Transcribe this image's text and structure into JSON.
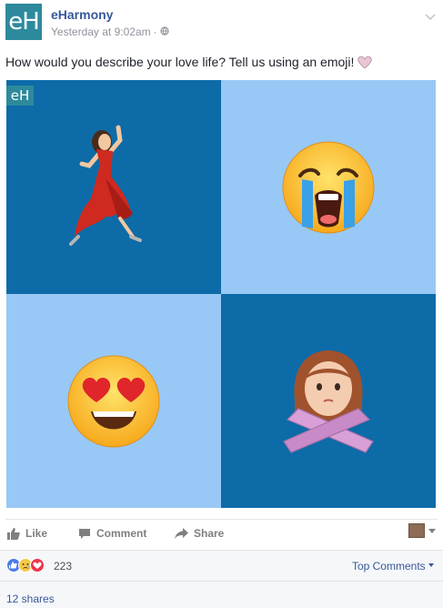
{
  "post": {
    "author": "eHarmony",
    "avatar_text": "eH",
    "timestamp": "Yesterday at 9:02am",
    "separator": "·",
    "message": "How would you describe your love life? Tell us using an emoji!"
  },
  "image": {
    "brand_text": "eH",
    "tiles": [
      {
        "emoji": "dancer-woman",
        "background": "#0d6ba8"
      },
      {
        "emoji": "loudly-crying-face",
        "background": "#98c8f5"
      },
      {
        "emoji": "heart-eyes-face",
        "background": "#98c8f5"
      },
      {
        "emoji": "no-gesture-woman",
        "background": "#0d6ba8"
      }
    ]
  },
  "actions": {
    "like_label": "Like",
    "comment_label": "Comment",
    "share_label": "Share"
  },
  "reactions": {
    "icons": [
      "like",
      "sad",
      "love"
    ],
    "count": "223",
    "sort_label": "Top Comments"
  },
  "shares": {
    "label": "12 shares"
  },
  "colors": {
    "link": "#365899",
    "brand": "#2d8a9c",
    "dark_tile": "#0d6ba8",
    "light_tile": "#98c8f5"
  }
}
